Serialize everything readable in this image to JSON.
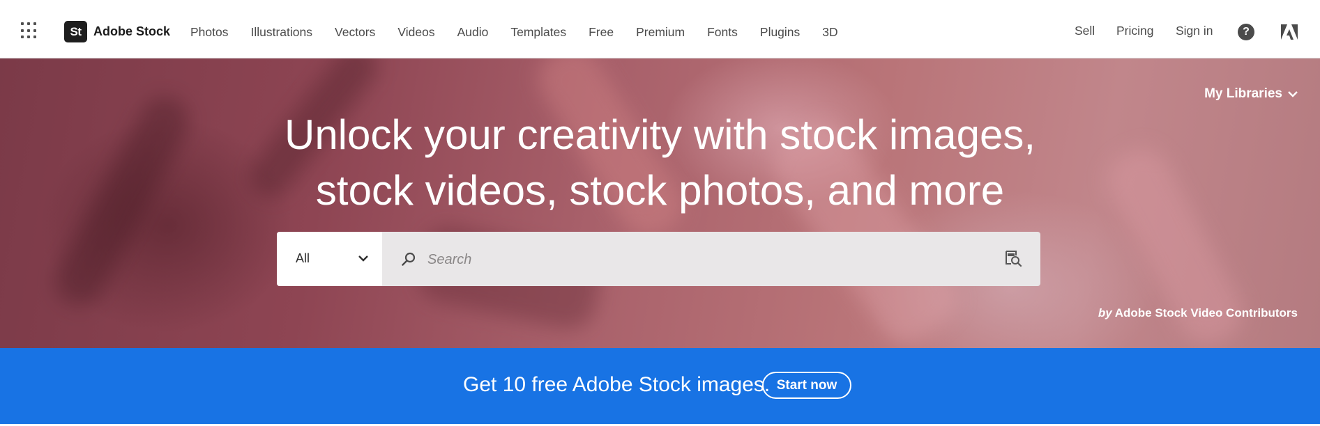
{
  "brand": {
    "logo_text": "St",
    "name": "Adobe Stock"
  },
  "nav": {
    "items": [
      {
        "label": "Photos"
      },
      {
        "label": "Illustrations"
      },
      {
        "label": "Vectors"
      },
      {
        "label": "Videos"
      },
      {
        "label": "Audio"
      },
      {
        "label": "Templates"
      },
      {
        "label": "Free"
      },
      {
        "label": "Premium"
      },
      {
        "label": "Fonts"
      },
      {
        "label": "Plugins"
      },
      {
        "label": "3D"
      }
    ],
    "right": {
      "sell": "Sell",
      "pricing": "Pricing",
      "sign_in": "Sign in"
    },
    "help_glyph": "?"
  },
  "hero": {
    "my_libraries": "My Libraries",
    "title_line1": "Unlock your creativity with stock images,",
    "title_line2": "stock videos, stock photos, and more",
    "search": {
      "scope": "All",
      "placeholder": "Search"
    },
    "credit_by": "by",
    "credit_name": "Adobe Stock Video Contributors"
  },
  "promo": {
    "text": "Get 10 free Adobe Stock images.",
    "button": "Start now"
  },
  "colors": {
    "promo_bg": "#1873e4",
    "hero_tone": "#a8606a",
    "logo_bg": "#1e1e1e"
  },
  "icons": [
    "app-switcher-icon",
    "help-icon",
    "adobe-logo-icon",
    "chevron-down-icon",
    "search-icon",
    "visual-search-icon"
  ]
}
